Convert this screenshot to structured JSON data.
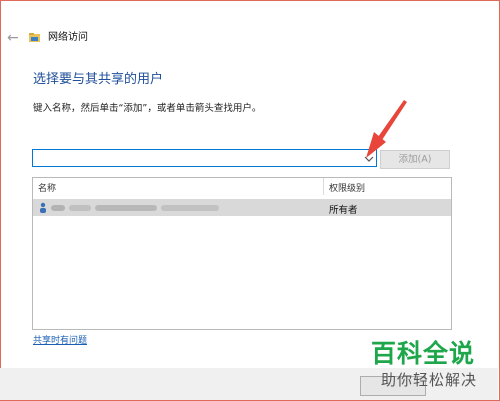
{
  "window": {
    "title": "网络访问",
    "back_icon": "back-arrow-icon",
    "title_icon": "network-folder-icon"
  },
  "content": {
    "heading": "选择要与其共享的用户",
    "instruction": "键入名称，然后单击“添加”，或者单击箭头查找用户。"
  },
  "name_input": {
    "value": "",
    "dropdown_icon": "chevron-down-icon"
  },
  "add_button": {
    "label": "添加(A)",
    "enabled": false
  },
  "table": {
    "columns": [
      "名称",
      "权限级别"
    ],
    "rows": [
      {
        "name_blurred": true,
        "permission": "所有者",
        "icon": "user-icon"
      }
    ]
  },
  "link": {
    "label": "共享时有问题"
  },
  "annotation": {
    "color": "#e8463b",
    "icon": "red-pointer-arrow"
  },
  "watermark": {
    "main": "百科全说",
    "sub": "助你轻松解决"
  },
  "colors": {
    "accent": "#0078d7",
    "heading": "#1f4e9a",
    "watermark_green": "#1ea64b"
  }
}
